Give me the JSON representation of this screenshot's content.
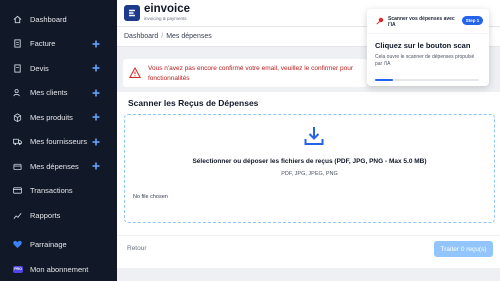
{
  "sidebar": {
    "items": [
      {
        "label": "Dashboard",
        "icon": "home-icon",
        "plus": false
      },
      {
        "label": "Facture",
        "icon": "document-icon",
        "plus": true
      },
      {
        "label": "Devis",
        "icon": "document-icon",
        "plus": true
      },
      {
        "label": "Mes clients",
        "icon": "users-icon",
        "plus": true
      },
      {
        "label": "Mes produits",
        "icon": "box-icon",
        "plus": true
      },
      {
        "label": "Mes fournisseurs",
        "icon": "truck-icon",
        "plus": true
      },
      {
        "label": "Mes dépenses",
        "icon": "wallet-icon",
        "plus": true
      },
      {
        "label": "Transactions",
        "icon": "card-icon",
        "plus": false
      },
      {
        "label": "Rapports",
        "icon": "chart-icon",
        "plus": false
      }
    ],
    "parrainage": "Parrainage",
    "abonnement": "Mon abonnement",
    "pro_badge": "PRO"
  },
  "topbar": {
    "logo_text": "einvoice",
    "logo_sub": "invoicing & payments"
  },
  "breadcrumb": {
    "root": "Dashboard",
    "separator": "/",
    "current": "Mes dépenses"
  },
  "warning": {
    "line1": "Vous n'avez pas encore confirmé votre email, veuillez le confirmer pour",
    "line2": "fonctionnalités"
  },
  "scanner": {
    "title": "Scanner les Reçus de Dépenses",
    "select_text": "Sélectionner ou déposer les fichiers de reçus (PDF, JPG, PNG - Max 5.0 MB)",
    "formats": "PDF, JPG, JPEG, PNG",
    "no_file": "No file chosen",
    "back_label": "Retour",
    "submit_label": "Traiter 0 reçu(s)"
  },
  "tour": {
    "header": "Scanner vos dépenses avec l'IA",
    "step": "Step 1",
    "title": "Cliquez sur le bouton scan",
    "description": "Cela ouvre le scanner de dépenses propulsé par l'IA",
    "progress": 0.17
  },
  "colors": {
    "sidebar_bg": "#111827",
    "accent": "#2563eb",
    "plus": "#60a5fa",
    "warning": "#b91c1c"
  }
}
